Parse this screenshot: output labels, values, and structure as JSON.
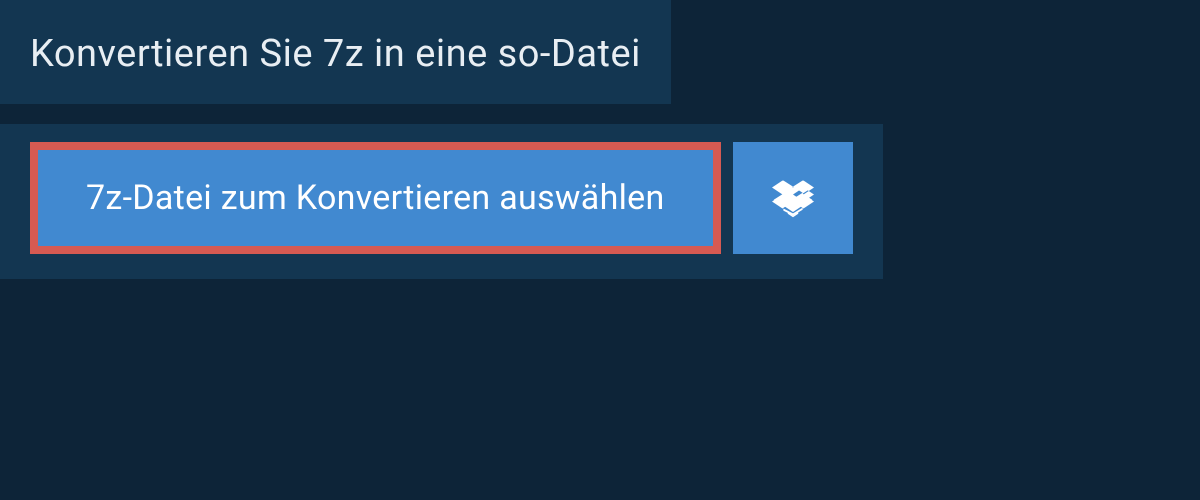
{
  "header": {
    "title": "Konvertieren Sie 7z in eine so-Datei"
  },
  "buttons": {
    "select_file_label": "7z-Datei zum Konvertieren auswählen",
    "dropbox_icon_name": "dropbox-icon"
  },
  "colors": {
    "background": "#0d2438",
    "panel": "#133651",
    "button_primary": "#4189d0",
    "highlight_border": "#d65a52"
  }
}
